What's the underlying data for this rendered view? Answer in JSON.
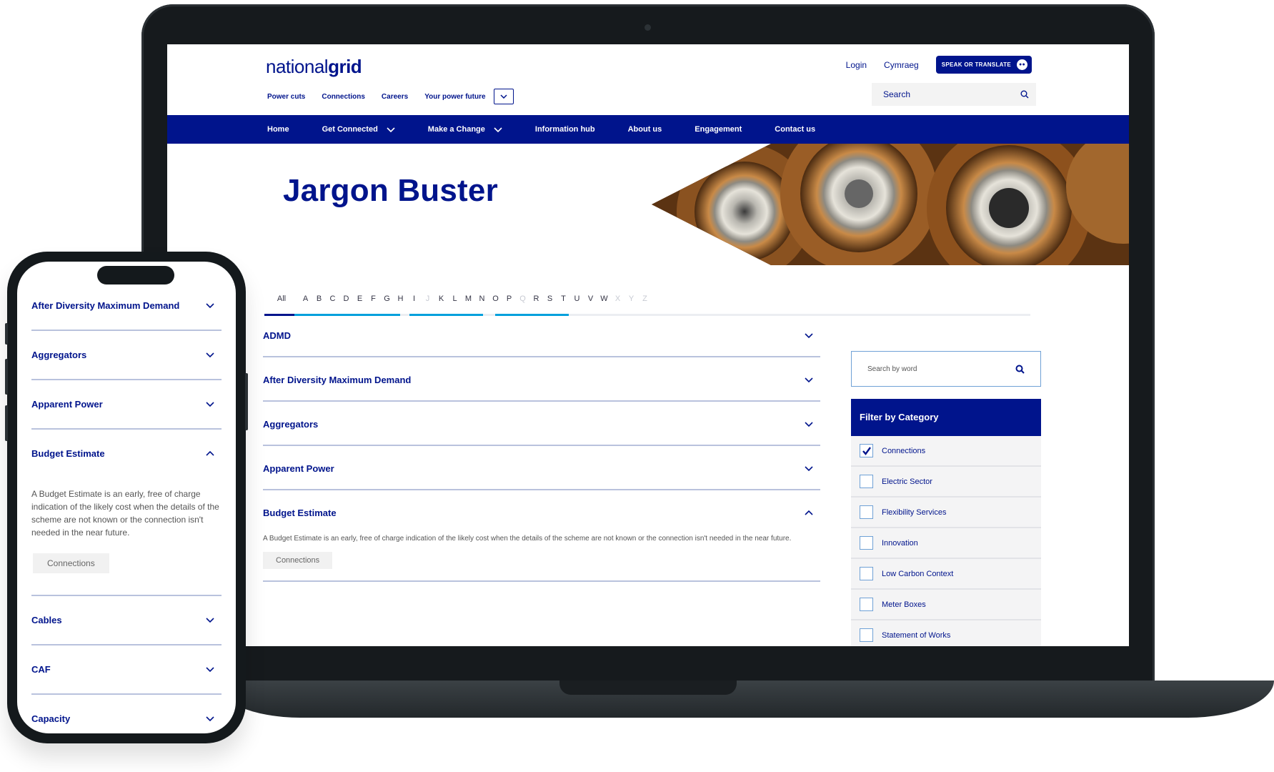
{
  "site": {
    "logo_light": "national",
    "logo_bold": "grid",
    "top_links": [
      "Login",
      "Cymraeg"
    ],
    "speak_label": "SPEAK OR TRANSLATE",
    "util_nav": [
      "Power cuts",
      "Connections",
      "Careers",
      "Your power future"
    ],
    "search_placeholder": "Search",
    "main_nav": [
      {
        "label": "Home",
        "has_menu": false
      },
      {
        "label": "Get Connected",
        "has_menu": true
      },
      {
        "label": "Make a Change",
        "has_menu": true
      },
      {
        "label": "Information hub",
        "has_menu": false
      },
      {
        "label": "About us",
        "has_menu": false
      },
      {
        "label": "Engagement",
        "has_menu": false
      },
      {
        "label": "Contact us",
        "has_menu": false
      }
    ]
  },
  "page": {
    "title": "Jargon Buster",
    "letters": [
      "All",
      "A",
      "B",
      "C",
      "D",
      "E",
      "F",
      "G",
      "H",
      "I",
      "J",
      "K",
      "L",
      "M",
      "N",
      "O",
      "P",
      "Q",
      "R",
      "S",
      "T",
      "U",
      "V",
      "W",
      "X",
      "Y",
      "Z"
    ],
    "letters_dim": [
      "J",
      "Q",
      "X",
      "Y",
      "Z"
    ]
  },
  "glossary": [
    {
      "term": "ADMD",
      "expanded": false
    },
    {
      "term": "After Diversity Maximum Demand",
      "expanded": false
    },
    {
      "term": "Aggregators",
      "expanded": false
    },
    {
      "term": "Apparent Power",
      "expanded": false
    },
    {
      "term": "Budget Estimate",
      "expanded": true,
      "definition": "A Budget Estimate is an early, free of charge indication of the likely cost when the details of the scheme are not known or the connection isn't needed in the near future.",
      "tag": "Connections"
    }
  ],
  "sidebar": {
    "search_placeholder": "Search by word",
    "filter_title": "Filter by Category",
    "categories": [
      {
        "label": "Connections",
        "checked": true
      },
      {
        "label": "Electric Sector",
        "checked": false
      },
      {
        "label": "Flexibility Services",
        "checked": false
      },
      {
        "label": "Innovation",
        "checked": false
      },
      {
        "label": "Low Carbon Context",
        "checked": false
      },
      {
        "label": "Meter Boxes",
        "checked": false
      },
      {
        "label": "Statement of Works",
        "checked": false
      }
    ]
  },
  "mobile": {
    "items": [
      {
        "term": "After Diversity Maximum Demand",
        "expanded": false
      },
      {
        "term": "Aggregators",
        "expanded": false
      },
      {
        "term": "Apparent Power",
        "expanded": false
      },
      {
        "term": "Budget Estimate",
        "expanded": true,
        "definition": "A Budget Estimate is an early, free of charge indication of the likely cost when the details of the scheme are not known or the connection isn't needed in the near future.",
        "tag": "Connections"
      },
      {
        "term": "Cables",
        "expanded": false
      },
      {
        "term": "CAF",
        "expanded": false
      },
      {
        "term": "Capacity",
        "expanded": false
      }
    ]
  },
  "colors": {
    "brand_navy": "#00148c",
    "accent_blue": "#00a0dc",
    "divider": "#b9c2dd"
  },
  "icons": {
    "search": "search-icon",
    "expand": "chevron-down-icon",
    "collapse": "chevron-up-icon",
    "check": "check-icon"
  }
}
